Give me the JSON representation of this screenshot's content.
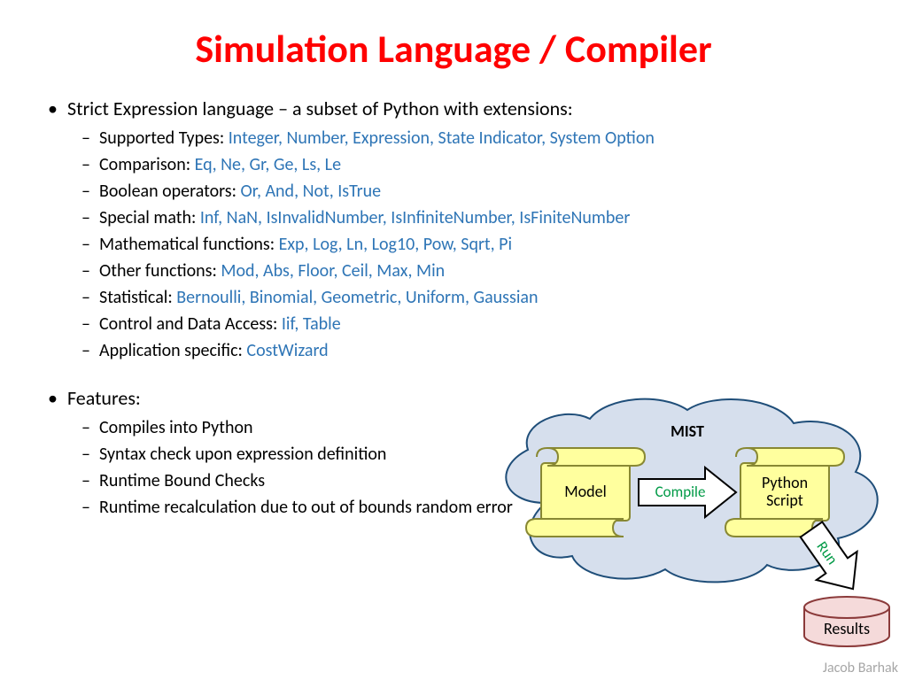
{
  "title": "Simulation Language / Compiler",
  "bullets": {
    "main1": "Strict Expression language – a subset of Python with extensions:",
    "types_label": "Supported Types: ",
    "types_val": "Integer, Number, Expression, State Indicator, System Option",
    "comp_label": "Comparison: ",
    "comp_val": "Eq, Ne, Gr, Ge, Ls, Le",
    "bool_label": "Boolean operators: ",
    "bool_val": "Or, And, Not, IsTrue",
    "math_label": "Special math: ",
    "math_val": "Inf, NaN, IsInvalidNumber, IsInfiniteNumber, IsFiniteNumber",
    "func_label": "Mathematical functions: ",
    "func_val": "Exp, Log, Ln, Log10, Pow, Sqrt, Pi",
    "other_label": "Other functions: ",
    "other_val": "Mod, Abs, Floor, Ceil, Max, Min",
    "stat_label": "Statistical: ",
    "stat_val": "Bernoulli, Binomial, Geometric, Uniform, Gaussian",
    "ctrl_label": "Control and Data Access: ",
    "ctrl_val": "Iif, Table",
    "app_label": "Application specific: ",
    "app_val": "CostWizard",
    "main2": "Features:",
    "f1": "Compiles into Python",
    "f2": "Syntax check upon expression definition",
    "f3": "Runtime Bound Checks",
    "f4": "Runtime recalculation due to out of bounds random error"
  },
  "diagram": {
    "cloud": "MIST",
    "box1": "Model",
    "box2_line1": "Python",
    "box2_line2": "Script",
    "arrow1": "Compile",
    "arrow2": "Run",
    "db": "Results"
  },
  "author": "Jacob Barhak"
}
